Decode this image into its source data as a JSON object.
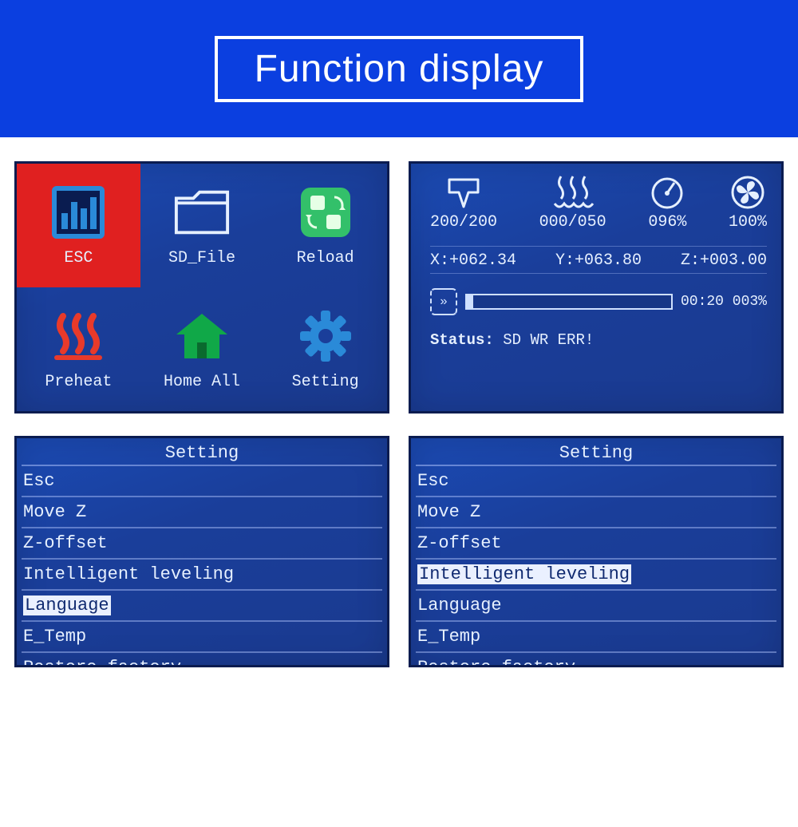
{
  "banner": {
    "title": "Function display"
  },
  "menu": {
    "items": [
      {
        "label": "ESC",
        "icon": "bars",
        "selected": true
      },
      {
        "label": "SD_File",
        "icon": "folder",
        "selected": false
      },
      {
        "label": "Reload",
        "icon": "reload",
        "selected": false
      },
      {
        "label": "Preheat",
        "icon": "heat",
        "selected": false
      },
      {
        "label": "Home All",
        "icon": "home",
        "selected": false
      },
      {
        "label": "Setting",
        "icon": "gear",
        "selected": false
      }
    ]
  },
  "status": {
    "hotend": "200/200",
    "bed": "000/050",
    "feed": "096%",
    "fan": "100%",
    "x": "X:+062.34",
    "y": "Y:+063.80",
    "z": "Z:+003.00",
    "progress_pct": 3,
    "progress_text": "00:20 003%",
    "status_label": "Status:",
    "status_value": "SD WR ERR!"
  },
  "settings_left": {
    "title": "Setting",
    "items": [
      "Esc",
      "Move Z",
      "Z-offset",
      "Intelligent leveling",
      "Language",
      "E_Temp",
      "Restore factory"
    ],
    "selected_index": 4
  },
  "settings_right": {
    "title": "Setting",
    "items": [
      "Esc",
      "Move Z",
      "Z-offset",
      "Intelligent leveling",
      "Language",
      "E_Temp",
      "Restore factory"
    ],
    "selected_index": 3
  },
  "colors": {
    "banner_bg": "#0b3fe0",
    "panel_bg": "#1a3e9a",
    "selected_bg": "#e02020",
    "icon_green": "#33c06a",
    "icon_red": "#e83a2a",
    "icon_blue": "#2a8ad8"
  }
}
